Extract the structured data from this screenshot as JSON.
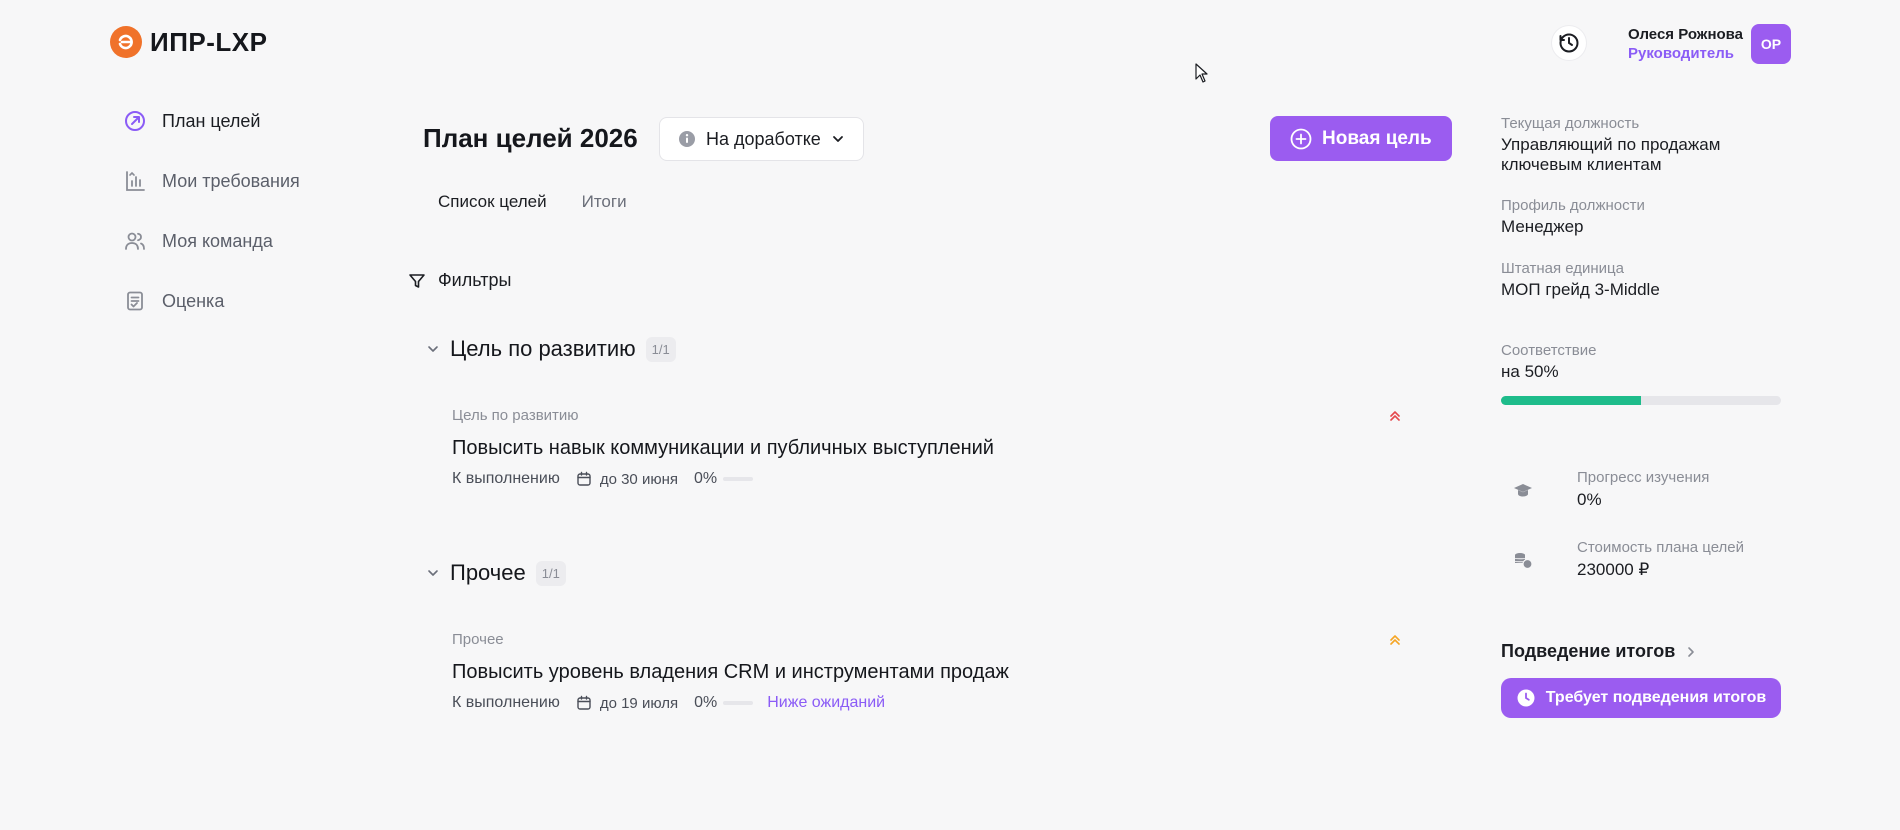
{
  "header": {
    "app_name": "ИПР-LXP",
    "user_name": "Олеся Рожнова",
    "user_role": "Руководитель",
    "avatar_initials": "ОР"
  },
  "sidebar": {
    "items": [
      {
        "label": "План целей",
        "icon": "goal-arrow-icon",
        "active": true
      },
      {
        "label": "Мои требования",
        "icon": "chart-icon",
        "active": false
      },
      {
        "label": "Моя команда",
        "icon": "team-icon",
        "active": false
      },
      {
        "label": "Оценка",
        "icon": "clipboard-icon",
        "active": false
      }
    ]
  },
  "main": {
    "title": "План целей 2026",
    "status_label": "На доработке",
    "new_goal_label": "Новая цель",
    "tabs": [
      {
        "label": "Список целей",
        "active": true
      },
      {
        "label": "Итоги",
        "active": false
      }
    ],
    "filters_label": "Фильтры",
    "groups": [
      {
        "title": "Цель по развитию",
        "count": "1/1",
        "goals": [
          {
            "category": "Цель по развитию",
            "name": "Повысить навык коммуникации и публичных выступлений",
            "status": "К выполнению",
            "due": "до 30 июня",
            "progress_text": "0%",
            "progress": 0,
            "priority_color": "#e5484d",
            "rating": ""
          }
        ]
      },
      {
        "title": "Прочее",
        "count": "1/1",
        "goals": [
          {
            "category": "Прочее",
            "name": "Повысить уровень владения CRM и инструментами продаж",
            "status": "К выполнению",
            "due": "до 19 июля",
            "progress_text": "0%",
            "progress": 0,
            "priority_color": "#f5a524",
            "rating": "Ниже ожиданий"
          }
        ]
      }
    ]
  },
  "right_panel": {
    "position_label": "Текущая должность",
    "position_value": "Управляющий по продажам ключевым клиентам",
    "profile_label": "Профиль должности",
    "profile_value": "Менеджер",
    "staff_unit_label": "Штатная единица",
    "staff_unit_value": "МОП грейд 3-Middle",
    "match_label": "Соответствие",
    "match_value": "на 50%",
    "match_progress": 0.5,
    "learning_label": "Прогресс изучения",
    "learning_value": "0%",
    "cost_label": "Стоимость плана целей",
    "cost_value": "230000 ₽",
    "summary_link": "Подведение итогов",
    "needs_summary": "Требует подведения итогов"
  },
  "colors": {
    "accent": "#9b5cf0",
    "success": "#1ebc8b",
    "logo": "#f0722a"
  }
}
